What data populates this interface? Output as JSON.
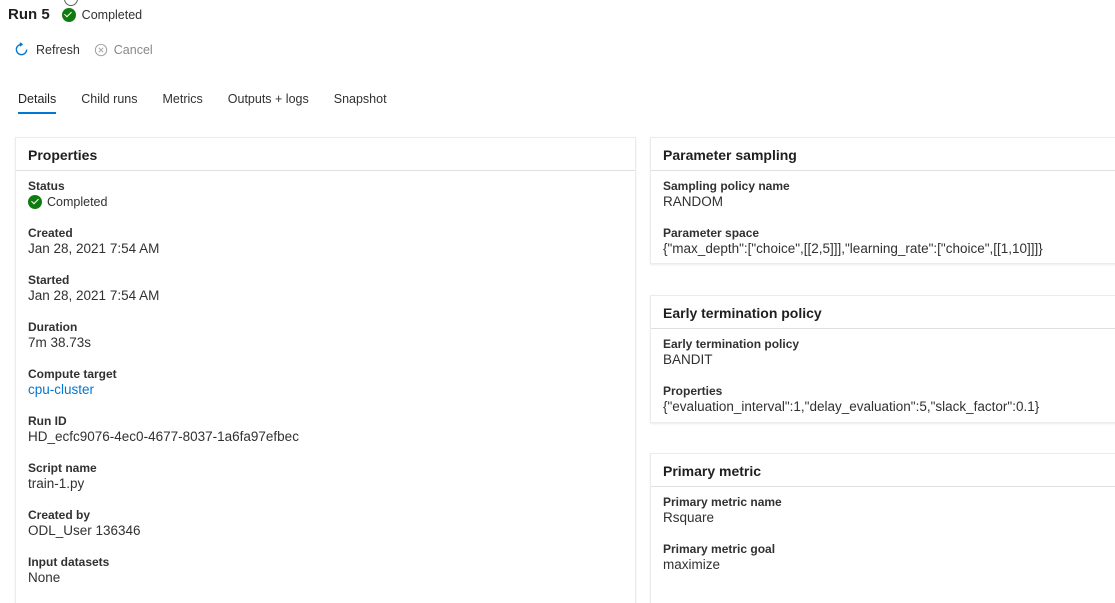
{
  "header": {
    "run_title": "Run 5",
    "status": "Completed"
  },
  "toolbar": {
    "refresh_label": "Refresh",
    "cancel_label": "Cancel"
  },
  "tabs": [
    {
      "label": "Details",
      "active": true
    },
    {
      "label": "Child runs"
    },
    {
      "label": "Metrics"
    },
    {
      "label": "Outputs + logs"
    },
    {
      "label": "Snapshot"
    }
  ],
  "properties": {
    "title": "Properties",
    "status_label": "Status",
    "status_value": "Completed",
    "created_label": "Created",
    "created_value": "Jan 28, 2021 7:54 AM",
    "started_label": "Started",
    "started_value": "Jan 28, 2021 7:54 AM",
    "duration_label": "Duration",
    "duration_value": "7m 38.73s",
    "compute_label": "Compute target",
    "compute_value": "cpu-cluster",
    "runid_label": "Run ID",
    "runid_value": "HD_ecfc9076-4ec0-4677-8037-1a6fa97efbec",
    "script_label": "Script name",
    "script_value": "train-1.py",
    "createdby_label": "Created by",
    "createdby_value": "ODL_User 136346",
    "datasets_label": "Input datasets",
    "datasets_value": "None"
  },
  "sampling": {
    "title": "Parameter sampling",
    "policy_label": "Sampling policy name",
    "policy_value": "RANDOM",
    "space_label": "Parameter space",
    "space_value": "{\"max_depth\":[\"choice\",[[2,5]]],\"learning_rate\":[\"choice\",[[1,10]]]}"
  },
  "termination": {
    "title": "Early termination policy",
    "policy_label": "Early termination policy",
    "policy_value": "BANDIT",
    "properties_label": "Properties",
    "properties_value": "{\"evaluation_interval\":1,\"delay_evaluation\":5,\"slack_factor\":0.1}"
  },
  "metric": {
    "title": "Primary metric",
    "name_label": "Primary metric name",
    "name_value": "Rsquare",
    "goal_label": "Primary metric goal",
    "goal_value": "maximize"
  },
  "colors": {
    "accent": "#0078d4",
    "success": "#107c10",
    "text": "#323130",
    "disabled": "#8a8886"
  }
}
